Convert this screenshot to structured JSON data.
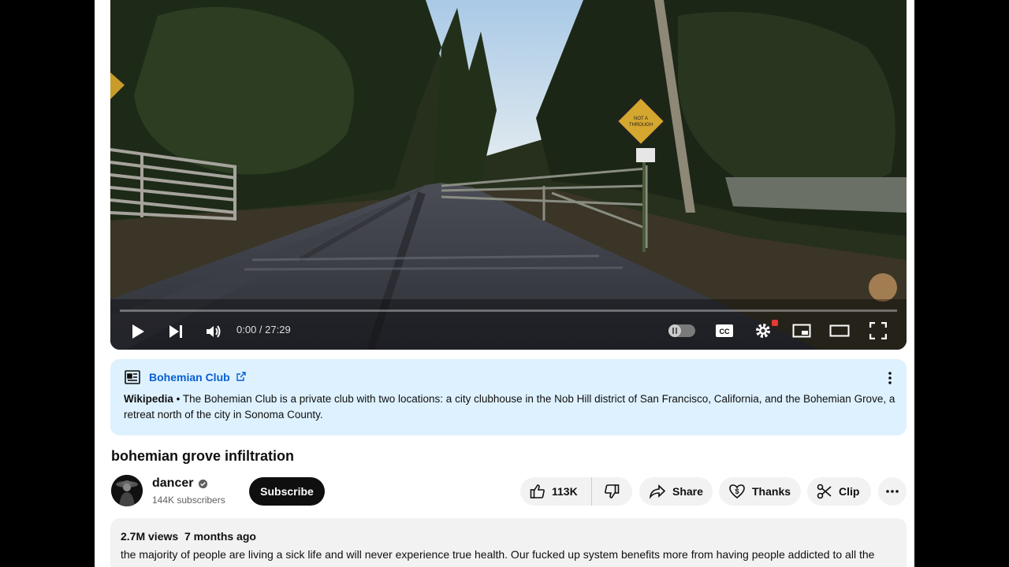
{
  "player": {
    "time": "0:00 / 27:29",
    "sign_text": "NOT A THROUGH ROAD"
  },
  "info_panel": {
    "title": "Bohemian Club",
    "source": "Wikipedia",
    "separator": " • ",
    "text": "The Bohemian Club is a private club with two locations: a city clubhouse in the Nob Hill district of San Francisco, California, and the Bohemian Grove, a retreat north of the city in Sonoma County."
  },
  "video": {
    "title": "bohemian grove infiltration"
  },
  "channel": {
    "name": "dancer",
    "subscribers": "144K subscribers",
    "subscribe_label": "Subscribe"
  },
  "actions": {
    "like_count": "113K",
    "share_label": "Share",
    "thanks_label": "Thanks",
    "clip_label": "Clip"
  },
  "description": {
    "views": "2.7M views",
    "age": "7 months ago",
    "text": "the majority of people are living a sick life and will never experience true health. Our fucked up system benefits more from having people addicted to all the"
  },
  "colors": {
    "info_bg": "#def1ff",
    "link": "#065fd4",
    "subscribe_bg": "#0f0f0f",
    "pill_bg": "#f2f2f2"
  }
}
